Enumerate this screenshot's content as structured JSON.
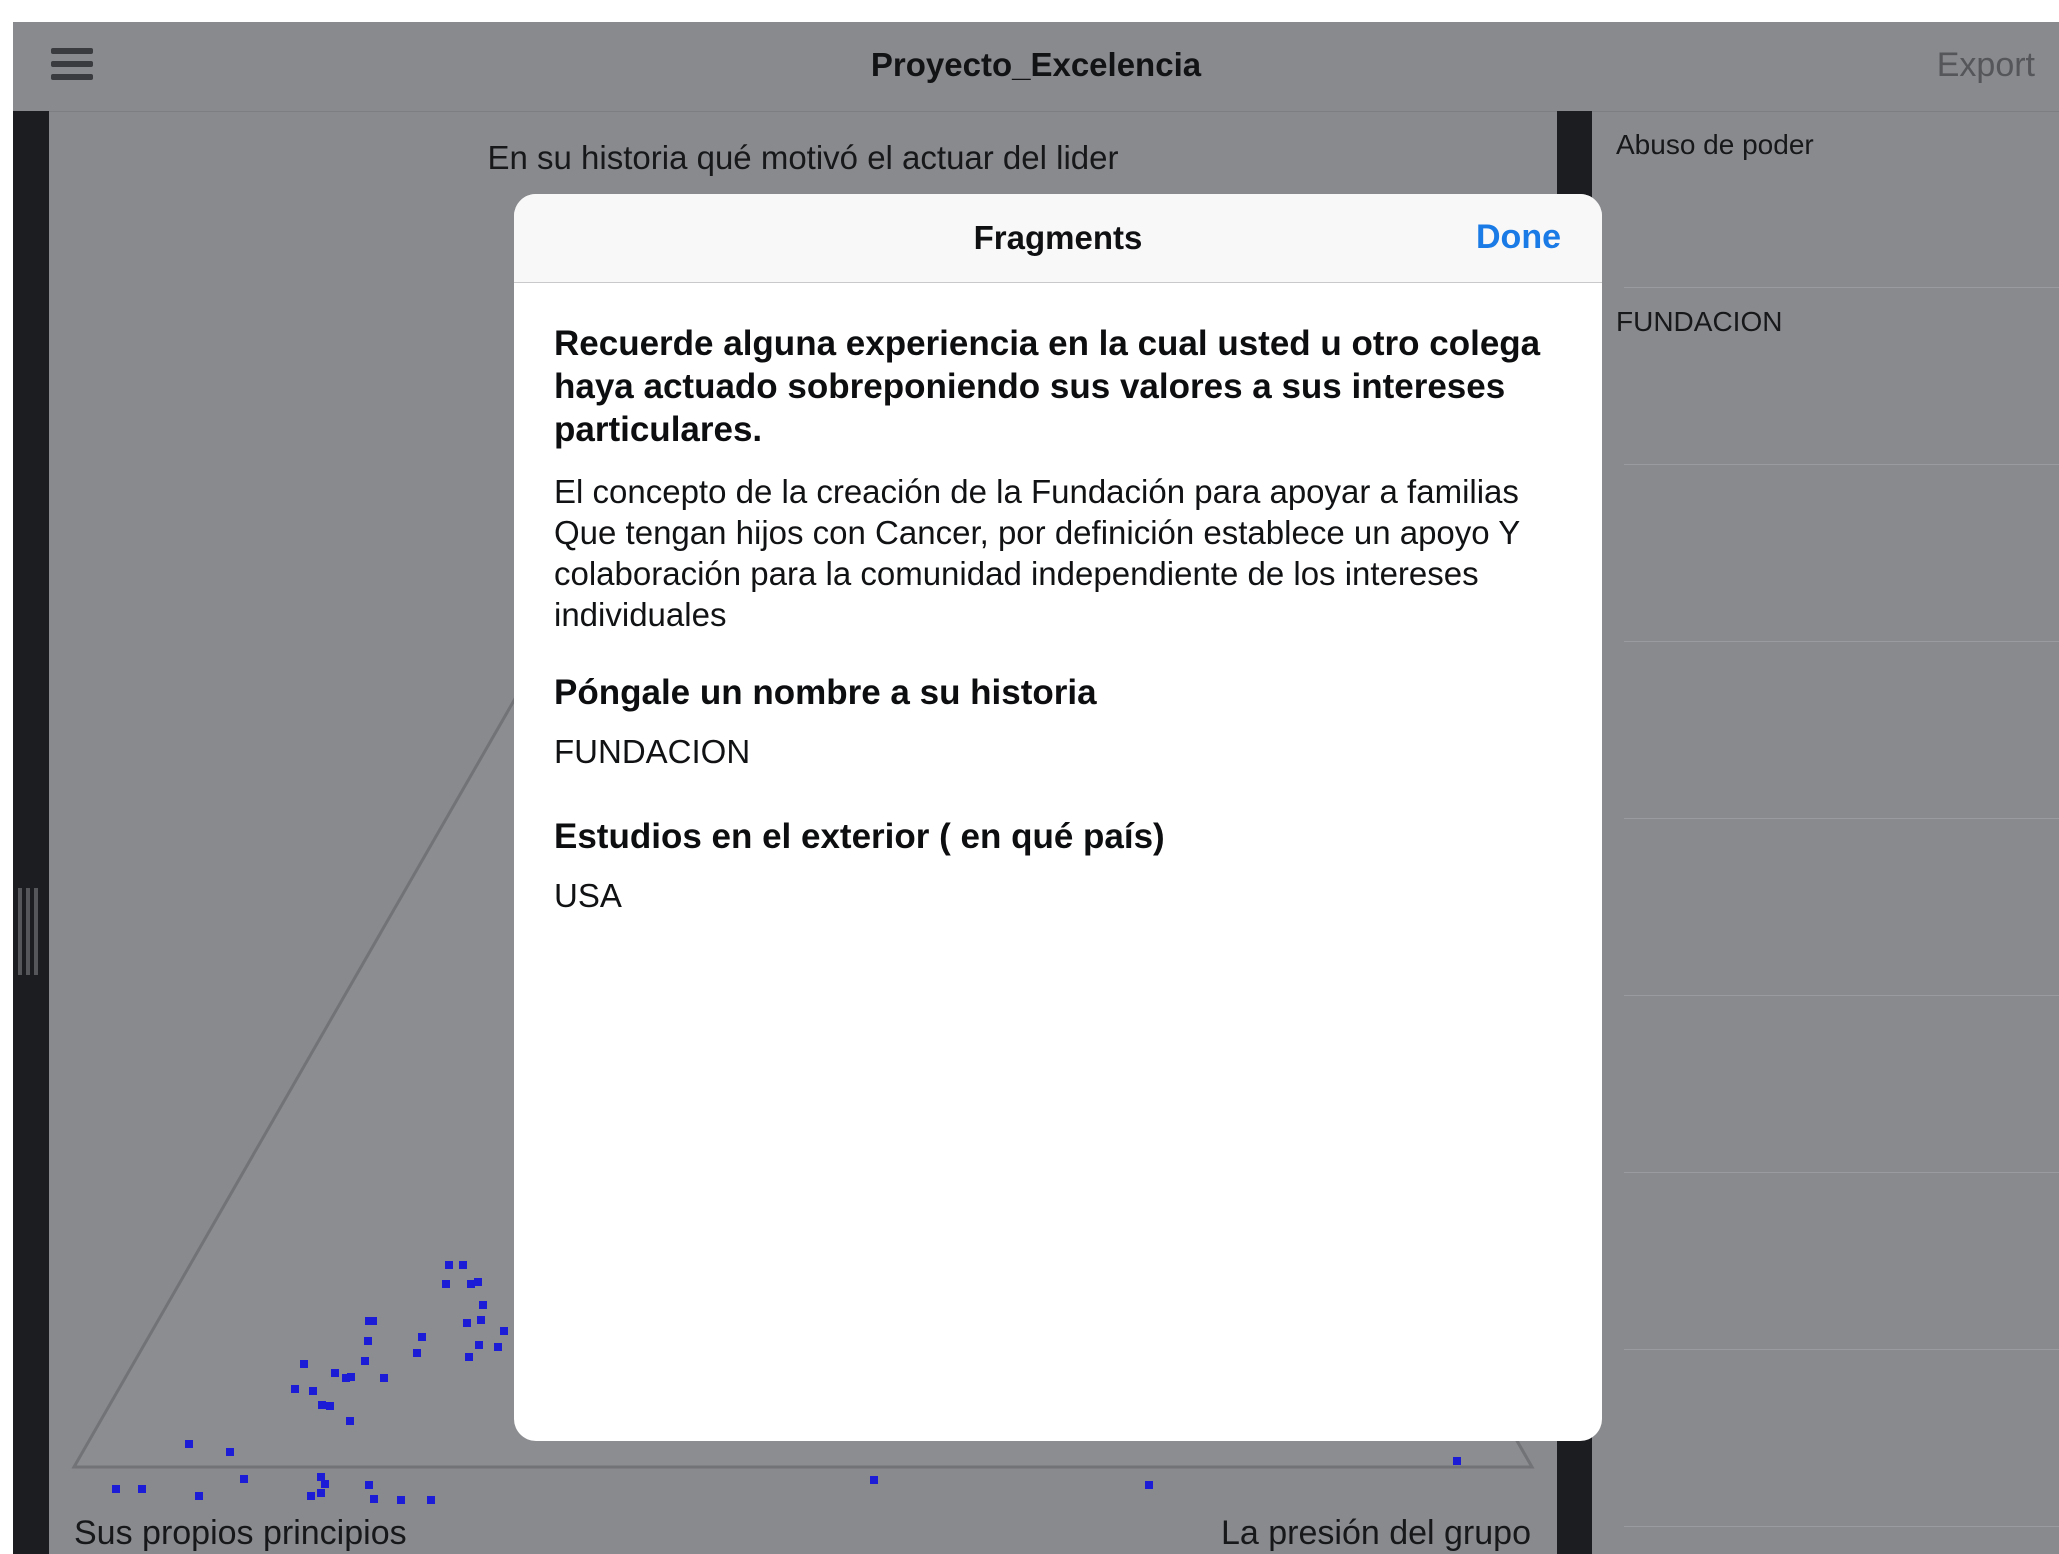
{
  "header": {
    "title": "Proyecto_Excelencia",
    "export_label": "Export"
  },
  "triangle": {
    "question": "En su historia qué motivó el actuar del lider",
    "left_corner_label": "Sus propios principios",
    "right_corner_label": "La presión del grupo",
    "dot_color": "#1c1cd6"
  },
  "stories": [
    {
      "label": "Abuso de poder"
    },
    {
      "label": "FUNDACION"
    },
    {
      "label": ""
    },
    {
      "label": ""
    },
    {
      "label": ""
    },
    {
      "label": ""
    },
    {
      "label": ""
    },
    {
      "label": ""
    }
  ],
  "modal": {
    "title": "Fragments",
    "done_label": "Done",
    "q1": "Recuerde alguna experiencia en la cual usted u otro colega haya actuado sobreponiendo sus valores a sus intereses particulares.",
    "a1": "El concepto de la creación de la Fundación para apoyar a familias Que tengan hijos con Cancer, por definición establece un apoyo Y colaboración para la comunidad independiente de los intereses individuales",
    "q2": "Póngale un nombre a su historia",
    "a2": "FUNDACION",
    "q3": "Estudios en el exterior ( en qué país)",
    "a3": "USA"
  },
  "colors": {
    "background": "#898a8e",
    "dark_bar": "#1c1d20",
    "accent": "#1a7ae6"
  }
}
